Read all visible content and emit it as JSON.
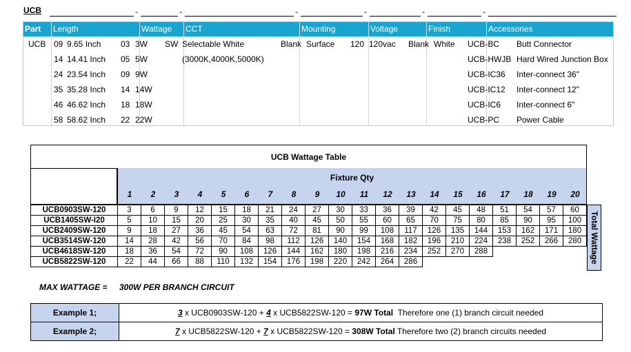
{
  "code_line": {
    "label": "UCB",
    "dash": "-"
  },
  "options": {
    "headers": [
      "Part",
      "Length",
      "Wattage",
      "CCT",
      "Mounting",
      "Voltage",
      "Finish",
      "Accessories"
    ],
    "part": "UCB",
    "length": [
      {
        "code": "09",
        "desc": "9.65 Inch"
      },
      {
        "code": "14",
        "desc": "14.41 Inch"
      },
      {
        "code": "24",
        "desc": "23.54 Inch"
      },
      {
        "code": "35",
        "desc": "35.28 Inch"
      },
      {
        "code": "46",
        "desc": "46.62 Inch"
      },
      {
        "code": "58",
        "desc": "58.62 Inch"
      }
    ],
    "wattage": [
      {
        "code": "03",
        "desc": "3W"
      },
      {
        "code": "05",
        "desc": "5W"
      },
      {
        "code": "09",
        "desc": "9W"
      },
      {
        "code": "14",
        "desc": "14W"
      },
      {
        "code": "18",
        "desc": "18W"
      },
      {
        "code": "22",
        "desc": "22W"
      }
    ],
    "cct": {
      "code": "SW",
      "desc": "Selectable White",
      "desc2": "(3000K,4000K,5000K)"
    },
    "mounting": {
      "code": "Blank",
      "desc": "Surface"
    },
    "voltage": {
      "code": "120",
      "desc": "120vac"
    },
    "finish": {
      "code": "Blank",
      "desc": "White"
    },
    "accessories": [
      {
        "code": "UCB-BC",
        "desc": "Butt Connector"
      },
      {
        "code": "UCB-HWJB",
        "desc": "Hard Wired Junction Box"
      },
      {
        "code": "UCB-IC36",
        "desc": "Inter-connect 36\""
      },
      {
        "code": "UCB-IC12",
        "desc": "Inter-connect 12\""
      },
      {
        "code": "UCB-IC6",
        "desc": "Inter-connect 6\""
      },
      {
        "code": "UCB-PC",
        "desc": "Power Cable"
      }
    ]
  },
  "wattage_table": {
    "title": "UCB Wattage Table",
    "qty_title": "Fixture Qty",
    "qty": [
      "1",
      "2",
      "3",
      "4",
      "5",
      "6",
      "7",
      "8",
      "9",
      "10",
      "11",
      "12",
      "13",
      "14",
      "15",
      "16",
      "17",
      "18",
      "19",
      "20"
    ],
    "side_label": "Total Wattage",
    "rows": [
      {
        "model": "UCB0903SW-120",
        "values": [
          "3",
          "6",
          "9",
          "12",
          "15",
          "18",
          "21",
          "24",
          "27",
          "30",
          "33",
          "36",
          "39",
          "42",
          "45",
          "48",
          "51",
          "54",
          "57",
          "60"
        ]
      },
      {
        "model": "UCB1405SW-I20",
        "values": [
          "5",
          "10",
          "15",
          "20",
          "25",
          "30",
          "35",
          "40",
          "45",
          "50",
          "55",
          "60",
          "65",
          "70",
          "75",
          "80",
          "85",
          "90",
          "95",
          "100"
        ]
      },
      {
        "model": "UCB2409SW-120",
        "values": [
          "9",
          "18",
          "27",
          "36",
          "45",
          "54",
          "63",
          "72",
          "81",
          "90",
          "99",
          "108",
          "117",
          "126",
          "135",
          "144",
          "153",
          "162",
          "171",
          "180"
        ]
      },
      {
        "model": "UCB3514SW-120",
        "values": [
          "14",
          "28",
          "42",
          "56",
          "70",
          "84",
          "98",
          "112",
          "126",
          "140",
          "154",
          "168",
          "182",
          "196",
          "210",
          "224",
          "238",
          "252",
          "266",
          "280"
        ]
      },
      {
        "model": "UCB4618SW-120",
        "values": [
          "18",
          "36",
          "54",
          "72",
          "90",
          "108",
          "126",
          "144",
          "162",
          "180",
          "198",
          "216",
          "234",
          "252",
          "270",
          "288"
        ]
      },
      {
        "model": "UCB5822SW-120",
        "values": [
          "22",
          "44",
          "66",
          "88",
          "110",
          "132",
          "154",
          "176",
          "198",
          "220",
          "242",
          "264",
          "286"
        ]
      }
    ]
  },
  "max_wattage": {
    "label": "MAX WATTAGE =",
    "value": "300W PER BRANCH CIRCUIT"
  },
  "examples": [
    {
      "label": "Example 1;",
      "q1": "3",
      "m1": " x UCB0903SW-120 + ",
      "q2": "4",
      "m2": " x UCB5822SW-120 = ",
      "total": "97W Total",
      "note": "  Therefore one (1) branch circuit needed"
    },
    {
      "label": "Example 2;",
      "q1": "7",
      "m1": " x UCB5822SW-120 + ",
      "q2": "7",
      "m2": " x UCB5822SW-120 = ",
      "total": "308W Total",
      "note": " Therefore two (2) branch circuits needed"
    }
  ]
}
